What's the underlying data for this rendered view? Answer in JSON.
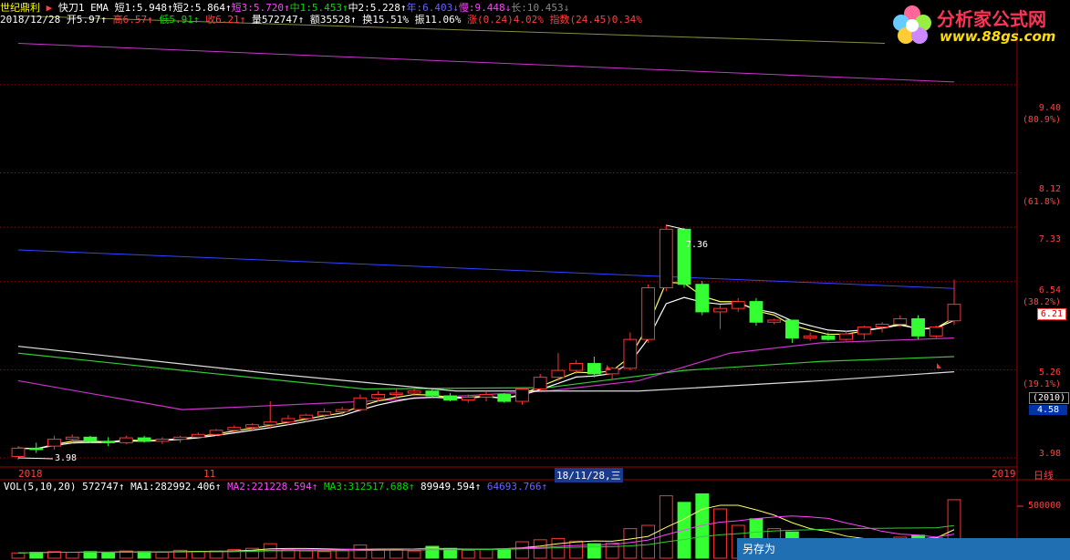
{
  "stock": {
    "name": "世纪鼎利",
    "indicator": "快刀1 EMA"
  },
  "ma_legend": [
    {
      "label": "短1:5.948↑",
      "color": "#ffffff"
    },
    {
      "label": "短2:5.864↑",
      "color": "#ffffff"
    },
    {
      "label": "短3:5.720↑",
      "color": "#ff44ff"
    },
    {
      "label": "中1:5.453↑",
      "color": "#00dd00"
    },
    {
      "label": "中2:5.228↑",
      "color": "#ffffff"
    },
    {
      "label": "年:6.403↓",
      "color": "#6666ff"
    },
    {
      "label": "慢:9.448↓",
      "color": "#ff44ff"
    },
    {
      "label": "长:10.453↓",
      "color": "#888888"
    }
  ],
  "quote": {
    "date": "2018/12/28",
    "open": "开5.97↑",
    "high": "高6.57↑",
    "low": "低5.91↑",
    "close": "收6.21↑",
    "volume": "量572747↑",
    "amount": "额35528↑",
    "turnover": "换15.51%",
    "amplitude": "振11.06%",
    "change": "涨(0.24)4.02%",
    "index": "指数(24.45)0.34%"
  },
  "price_axis": {
    "labels": [
      "9.40",
      "8.12",
      "7.33",
      "6.54",
      "5.26",
      "3.98"
    ],
    "pcts": [
      "(80.9%)",
      "(61.8%)",
      "(38.2%)",
      "(19.1%)"
    ],
    "current": "6.21",
    "year_badge": "(2010)",
    "value_badge": "4.58",
    "high_mark": "7.36",
    "low_mark": "3.98"
  },
  "x_axis": {
    "left": "2018",
    "mid": "11",
    "cursor": "18/11/28,三",
    "right": "2019",
    "period": "日线"
  },
  "volume": {
    "header": "VOL(5,10,20)",
    "value": "572747↑",
    "ma1": "MA1:282992.406↑",
    "ma2": "MA2:221228.594↑",
    "ma3": "MA3:312517.688↑",
    "v4": "89949.594↑",
    "v5": "64693.766↑",
    "axis_label": "500000"
  },
  "logo": {
    "title": "分析家公式网",
    "url": "www.88gs.com"
  },
  "popup": {
    "label": "另存为"
  },
  "chart_data": {
    "type": "candlestick",
    "ylim": [
      3.9,
      10.1
    ],
    "candles": [
      [
        4.0,
        4.15,
        3.95,
        4.12
      ],
      [
        4.12,
        4.2,
        4.05,
        4.1
      ],
      [
        4.15,
        4.3,
        4.1,
        4.25
      ],
      [
        4.25,
        4.32,
        4.2,
        4.28
      ],
      [
        4.28,
        4.3,
        4.2,
        4.22
      ],
      [
        4.22,
        4.28,
        4.15,
        4.2
      ],
      [
        4.2,
        4.3,
        4.18,
        4.27
      ],
      [
        4.27,
        4.3,
        4.2,
        4.22
      ],
      [
        4.22,
        4.28,
        4.18,
        4.25
      ],
      [
        4.25,
        4.3,
        4.2,
        4.28
      ],
      [
        4.28,
        4.35,
        4.25,
        4.32
      ],
      [
        4.32,
        4.4,
        4.3,
        4.38
      ],
      [
        4.38,
        4.45,
        4.35,
        4.42
      ],
      [
        4.42,
        4.48,
        4.38,
        4.46
      ],
      [
        4.46,
        4.8,
        4.4,
        4.5
      ],
      [
        4.5,
        4.6,
        4.45,
        4.55
      ],
      [
        4.55,
        4.62,
        4.5,
        4.6
      ],
      [
        4.6,
        4.7,
        4.55,
        4.65
      ],
      [
        4.65,
        4.72,
        4.6,
        4.68
      ],
      [
        4.68,
        4.9,
        4.65,
        4.85
      ],
      [
        4.85,
        4.95,
        4.8,
        4.9
      ],
      [
        4.9,
        4.98,
        4.85,
        4.92
      ],
      [
        4.92,
        4.98,
        4.88,
        4.95
      ],
      [
        4.95,
        4.98,
        4.85,
        4.88
      ],
      [
        4.88,
        4.92,
        4.8,
        4.82
      ],
      [
        4.82,
        4.9,
        4.78,
        4.86
      ],
      [
        4.86,
        4.95,
        4.8,
        4.9
      ],
      [
        4.9,
        4.92,
        4.78,
        4.8
      ],
      [
        4.8,
        5.0,
        4.75,
        4.98
      ],
      [
        4.98,
        5.2,
        4.95,
        5.15
      ],
      [
        5.15,
        5.5,
        5.1,
        5.25
      ],
      [
        5.25,
        5.4,
        5.2,
        5.35
      ],
      [
        5.35,
        5.45,
        5.15,
        5.2
      ],
      [
        5.2,
        5.3,
        5.12,
        5.28
      ],
      [
        5.28,
        5.8,
        5.25,
        5.7
      ],
      [
        5.7,
        6.5,
        5.65,
        6.45
      ],
      [
        6.45,
        7.36,
        6.4,
        7.3
      ],
      [
        7.3,
        7.32,
        6.45,
        6.5
      ],
      [
        6.5,
        6.55,
        6.05,
        6.1
      ],
      [
        6.1,
        6.2,
        5.85,
        6.15
      ],
      [
        6.15,
        6.3,
        6.1,
        6.25
      ],
      [
        6.25,
        6.3,
        5.9,
        5.95
      ],
      [
        5.95,
        6.0,
        5.92,
        5.98
      ],
      [
        5.98,
        5.95,
        5.65,
        5.72
      ],
      [
        5.72,
        5.8,
        5.68,
        5.75
      ],
      [
        5.75,
        5.8,
        5.68,
        5.7
      ],
      [
        5.7,
        5.82,
        5.68,
        5.78
      ],
      [
        5.78,
        5.9,
        5.7,
        5.88
      ],
      [
        5.88,
        5.95,
        5.8,
        5.92
      ],
      [
        5.92,
        6.05,
        5.88,
        6.0
      ],
      [
        6.0,
        6.05,
        5.7,
        5.75
      ],
      [
        5.75,
        5.9,
        5.72,
        5.88
      ],
      [
        5.97,
        6.57,
        5.91,
        6.21
      ]
    ],
    "volume": [
      0.8,
      0.9,
      1.0,
      0.9,
      1.0,
      0.8,
      1.1,
      1.0,
      0.9,
      1.2,
      1.0,
      1.1,
      1.3,
      1.5,
      2.2,
      1.3,
      1.1,
      1.0,
      1.2,
      2.0,
      1.4,
      1.3,
      1.1,
      1.8,
      1.5,
      1.2,
      1.3,
      1.4,
      2.5,
      2.8,
      3.0,
      2.6,
      2.2,
      2.3,
      4.5,
      5.0,
      9.5,
      8.5,
      9.8,
      7.5,
      5.0,
      6.0,
      4.5,
      4.0,
      3.0,
      2.8,
      2.5,
      2.6,
      3.0,
      3.2,
      3.5,
      3.1,
      8.9
    ]
  }
}
